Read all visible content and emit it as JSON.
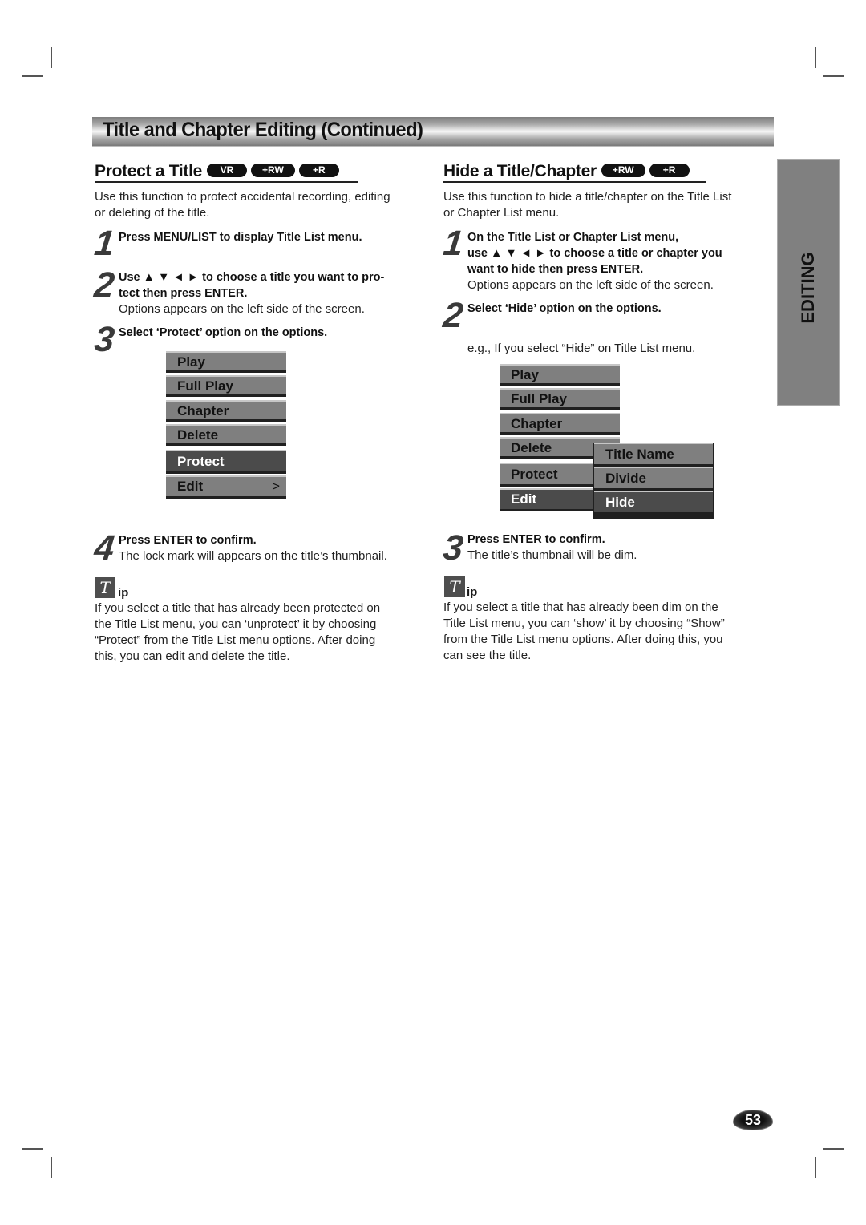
{
  "header": {
    "title": "Title and Chapter Editing (Continued)"
  },
  "side_tab": {
    "label": "EDITING"
  },
  "page_number": "53",
  "protect": {
    "title": "Protect a Title",
    "badges": [
      "VR",
      "+RW",
      "+R"
    ],
    "intro": [
      "Use this function to protect accidental recording, editing",
      "or deleting of the title."
    ],
    "steps": [
      {
        "num": "1",
        "bold": [
          "Press MENU/LIST to display Title List menu."
        ],
        "text": []
      },
      {
        "num": "2",
        "bold": [
          "Use ▲ ▼ ◄ ► to choose a title you want to pro-",
          "tect then press ENTER."
        ],
        "text": [
          "Options appears on the left side of the screen."
        ]
      },
      {
        "num": "3",
        "bold": [
          "Select ‘Protect’ option on the options."
        ],
        "text": []
      },
      {
        "num": "4",
        "bold": [
          "Press ENTER to confirm."
        ],
        "text": [
          "The lock mark will appears on the title’s thumbnail."
        ]
      }
    ],
    "menu": {
      "items": [
        "Play",
        "Full Play",
        "Chapter",
        "Delete",
        "Protect",
        "Edit"
      ],
      "selected": "Protect",
      "edit_chevron": ">"
    },
    "tip": {
      "icon": "T",
      "label": "ip",
      "lines": [
        "If you select a title that has already been protected on",
        "the Title List menu, you can ‘unprotect’ it by choosing",
        "“Protect” from the Title List menu options. After doing",
        "this, you can edit and delete the title."
      ]
    }
  },
  "hide": {
    "title": "Hide a Title/Chapter",
    "badges": [
      "+RW",
      "+R"
    ],
    "intro": [
      "Use this function to hide a title/chapter on the Title List",
      "or Chapter List menu."
    ],
    "steps": [
      {
        "num": "1",
        "bold": [
          "On the Title List or Chapter List menu,",
          "use ▲ ▼ ◄ ► to choose a title or chapter you",
          "want to hide then press ENTER."
        ],
        "text": [
          "Options appears on the left side of the screen."
        ]
      },
      {
        "num": "2",
        "bold": [
          "Select ‘Hide’ option on the options."
        ],
        "text": []
      },
      {
        "num": "3",
        "bold": [
          "Press ENTER to confirm."
        ],
        "text": [
          "The title’s thumbnail will be dim."
        ]
      }
    ],
    "example": "e.g., If you select “Hide” on Title List menu.",
    "menu": {
      "items": [
        "Play",
        "Full Play",
        "Chapter",
        "Delete",
        "Protect",
        "Edit"
      ],
      "selected": "Edit",
      "submenu": [
        "Title Name",
        "Divide",
        "Hide"
      ],
      "submenu_selected": "Hide"
    },
    "tip": {
      "icon": "T",
      "label": "ip",
      "lines": [
        "If you select a title that has already been dim on the",
        "Title List menu, you can ‘show’ it by choosing “Show”",
        "from the Title List menu options. After doing this, you",
        "can see the title."
      ]
    }
  }
}
